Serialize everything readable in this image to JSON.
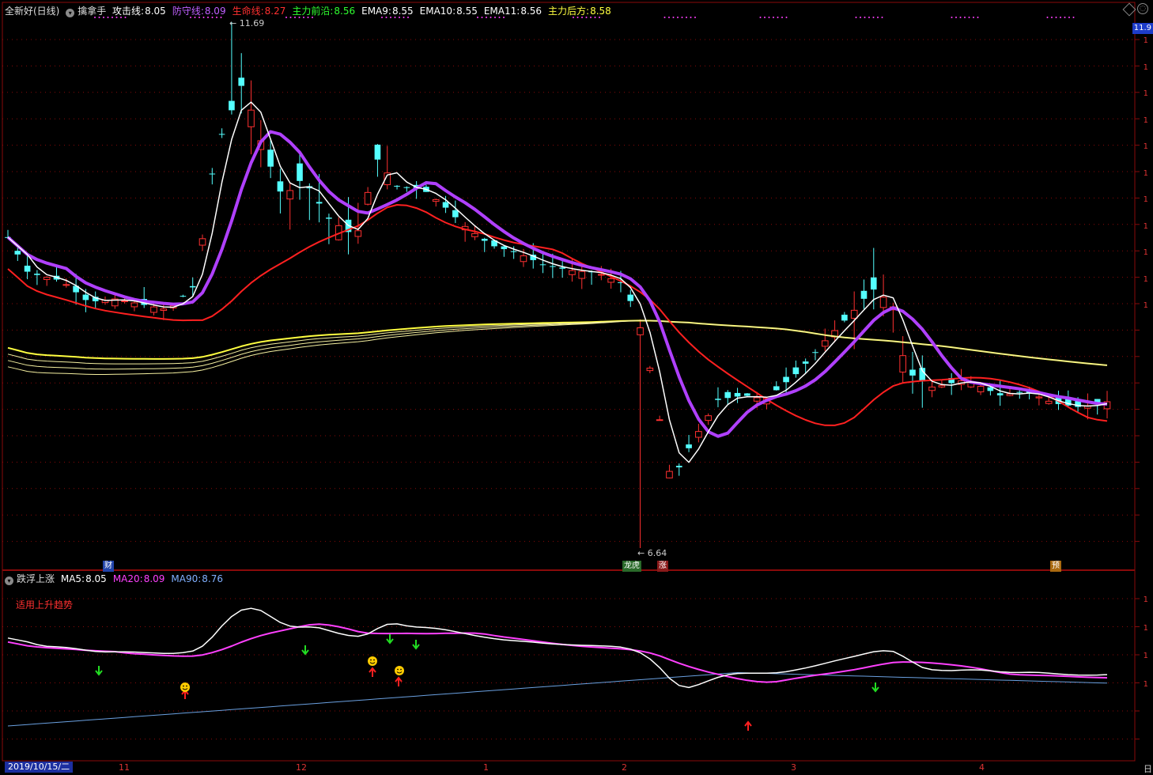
{
  "header": {
    "stock": "全新好(日线)",
    "indicator_name": "擒拿手",
    "items": [
      {
        "label": "攻击线:",
        "value": "8.05",
        "color": "#ffffff"
      },
      {
        "label": "防守线:",
        "value": "8.09",
        "color": "#c060ff"
      },
      {
        "label": "生命线:",
        "value": "8.27",
        "color": "#ff3030"
      },
      {
        "label": "主力前沿:",
        "value": "8.56",
        "color": "#30ff30"
      },
      {
        "label": "EMA9:",
        "value": "8.55",
        "color": "#ffffff"
      },
      {
        "label": "EMA10:",
        "value": "8.55",
        "color": "#ffffff"
      },
      {
        "label": "EMA11:",
        "value": "8.56",
        "color": "#ffffff"
      },
      {
        "label": "主力后方:",
        "value": "8.58",
        "color": "#ffff40"
      }
    ]
  },
  "sub_header": {
    "indicator_name": "跌浮上涨",
    "items": [
      {
        "label": "MA5:",
        "value": "8.05",
        "color": "#ffffff"
      },
      {
        "label": "MA20:",
        "value": "8.09",
        "color": "#ff40ff"
      },
      {
        "label": "MA90:",
        "value": "8.76",
        "color": "#80b0ff"
      }
    ]
  },
  "note": "适用上升趋势",
  "price_high_label": "11.69",
  "price_low_label": "6.64",
  "right_price_box": "11.9",
  "markers": [
    {
      "text": "财",
      "color": "#2244aa"
    },
    {
      "text": "龙虎",
      "color": "#2a6a2a"
    },
    {
      "text": "涨",
      "color": "#8a1a1a"
    },
    {
      "text": "预",
      "color": "#aa6a10"
    }
  ],
  "date_box": "2019/10/15/二",
  "x_ticks": [
    "11",
    "12",
    "1",
    "2",
    "3",
    "4"
  ],
  "right_corner_label": "日",
  "colors": {
    "up": "#ff3030",
    "down": "#54ffff",
    "white": "#ffffff",
    "purple": "#b040ff",
    "red_line": "#ff2020",
    "yellow": "#ffff40",
    "magenta": "#ff40ff",
    "blue_line": "#6aa0e0",
    "grid": "#8a0a0a"
  },
  "chart_data": {
    "type": "candlestick",
    "n_bars": 114,
    "price_range_visible": [
      6.5,
      12.0
    ],
    "key_points": [
      {
        "label": "high",
        "price": 11.69
      },
      {
        "label": "low",
        "price": 6.64
      }
    ],
    "marker_events": [
      "buy-arrows",
      "sell-arrows",
      "smiley"
    ],
    "sub_chart": {
      "series": [
        {
          "name": "MA5"
        },
        {
          "name": "MA20"
        },
        {
          "name": "MA90"
        }
      ]
    }
  }
}
